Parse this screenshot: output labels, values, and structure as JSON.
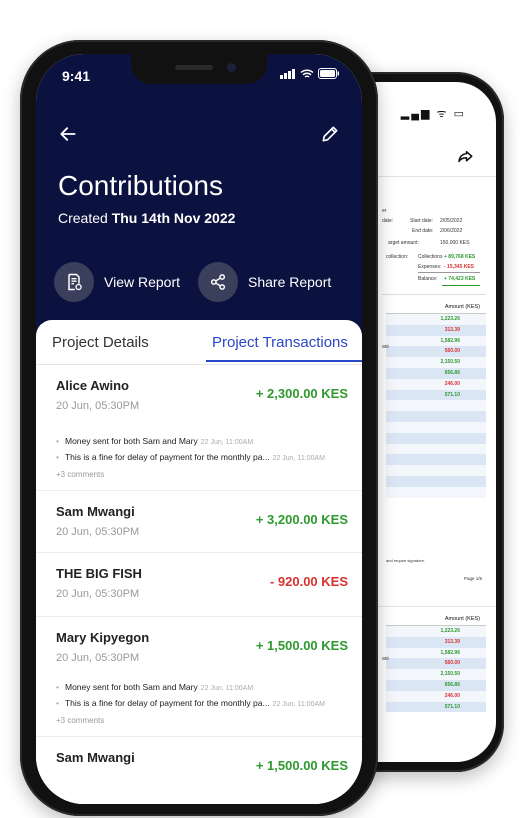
{
  "front": {
    "status": {
      "time": "9:41"
    },
    "header": {
      "title": "Contributions",
      "created_prefix": "Created",
      "created_date": "Thu 14th Nov 2022",
      "view_report": "View Report",
      "share_report": "Share Report"
    },
    "tabs": [
      {
        "label": "Project Details",
        "active": false
      },
      {
        "label": "Project Transactions",
        "active": true
      }
    ],
    "transactions": [
      {
        "name": "Alice Awino",
        "date": "20 Jun, 05:30PM",
        "amount": "+ 2,300.00 KES",
        "type": "pos",
        "comments": [
          {
            "text": "Money sent for both Sam and Mary",
            "time": "22 Jun, 11:00AM"
          },
          {
            "text": "This is a fine for delay of payment for the monthly pa...",
            "time": "22 Jun, 11:00AM"
          }
        ],
        "more": "+3 comments"
      },
      {
        "name": "Sam Mwangi",
        "date": "20 Jun, 05:30PM",
        "amount": "+ 3,200.00 KES",
        "type": "pos"
      },
      {
        "name": "THE BIG FISH",
        "date": "20 Jun, 05:30PM",
        "amount": "- 920.00 KES",
        "type": "neg"
      },
      {
        "name": "Mary Kipyegon",
        "date": "20 Jun, 05:30PM",
        "amount": "+ 1,500.00 KES",
        "type": "pos",
        "comments": [
          {
            "text": "Money sent for both Sam and Mary",
            "time": "22 Jun, 11:00AM"
          },
          {
            "text": "This is a fine for delay of payment for the monthly pa...",
            "time": "22 Jun, 11:00AM"
          }
        ],
        "more": "+3 comments"
      },
      {
        "name": "Sam Mwangi",
        "date": "",
        "amount": "+ 1,500.00 KES",
        "type": "pos"
      }
    ]
  },
  "back": {
    "summary": {
      "start_label": "Start date:",
      "start_value": "2/05/2022",
      "end_label": "End date:",
      "end_value": "2/06/2022",
      "target_label": "arget amount:",
      "target_value": "150,000 KES",
      "collections_label": "Collections",
      "collections_value": "+ 89,768 KES",
      "expenses_label": "Expenses:",
      "expenses_value": "- 15,345 KES",
      "balance_label": "Balance:",
      "balance_value": "+ 74,423 KES",
      "frag_start": "date:",
      "frag_end": "date:",
      "frag_collection": "collection:",
      "frag_er": "er"
    },
    "table1": {
      "header": "Amount (KES)",
      "rows": [
        {
          "v": "1,223.26",
          "t": "pos"
        },
        {
          "v": "313.39",
          "t": "neg"
        },
        {
          "v": "1,582.96",
          "t": "pos"
        },
        {
          "v": "560.00",
          "t": "neg"
        },
        {
          "v": "2,150.50",
          "t": "pos"
        },
        {
          "v": "656.86",
          "t": "pos"
        },
        {
          "v": "246.00",
          "t": "neg"
        },
        {
          "v": "571.10",
          "t": "pos"
        },
        {
          "v": "",
          "t": "pos"
        },
        {
          "v": "",
          "t": "pos"
        },
        {
          "v": "",
          "t": "pos"
        },
        {
          "v": "",
          "t": "pos"
        },
        {
          "v": "",
          "t": "pos"
        },
        {
          "v": "",
          "t": "pos"
        },
        {
          "v": "",
          "t": "pos"
        },
        {
          "v": "",
          "t": "pos"
        },
        {
          "v": "",
          "t": "pos"
        }
      ]
    },
    "footer_note": "and require signature.",
    "page": "Page 1/5",
    "table2": {
      "header": "Amount (KES)",
      "rows": [
        {
          "v": "1,223.26",
          "t": "pos"
        },
        {
          "v": "313.39",
          "t": "neg"
        },
        {
          "v": "1,582.96",
          "t": "pos"
        },
        {
          "v": "560.00",
          "t": "neg"
        },
        {
          "v": "2,150.50",
          "t": "pos"
        },
        {
          "v": "656.86",
          "t": "pos"
        },
        {
          "v": "246.00",
          "t": "neg"
        },
        {
          "v": "571.10",
          "t": "pos"
        }
      ]
    },
    "frag_ani": "ani"
  },
  "colors": {
    "navy": "#0c1240",
    "accent": "#2a46c9",
    "positive": "#2e9a2e",
    "negative": "#d8322e"
  }
}
